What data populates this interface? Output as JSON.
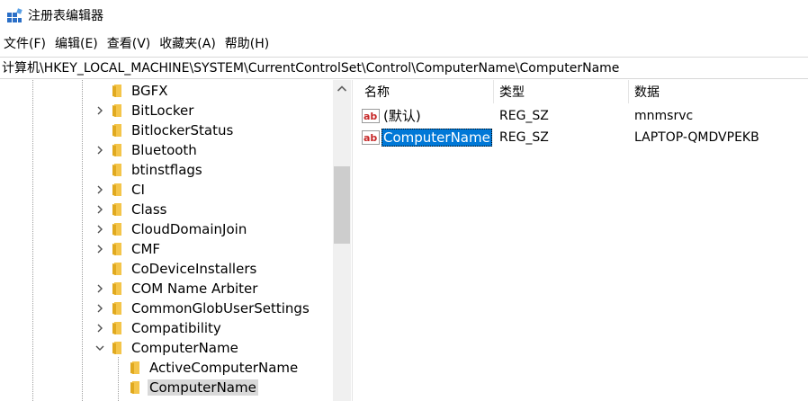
{
  "window": {
    "title": "注册表编辑器",
    "icon": "regedit-icon"
  },
  "menu": [
    "文件(F)",
    "编辑(E)",
    "查看(V)",
    "收藏夹(A)",
    "帮助(H)"
  ],
  "address": "计算机\\HKEY_LOCAL_MACHINE\\SYSTEM\\CurrentControlSet\\Control\\ComputerName\\ComputerName",
  "tree": {
    "items": [
      {
        "label": "BGFX",
        "expander": "none"
      },
      {
        "label": "BitLocker",
        "expander": "collapsed"
      },
      {
        "label": "BitlockerStatus",
        "expander": "none"
      },
      {
        "label": "Bluetooth",
        "expander": "collapsed"
      },
      {
        "label": "btinstflags",
        "expander": "none"
      },
      {
        "label": "CI",
        "expander": "collapsed"
      },
      {
        "label": "Class",
        "expander": "collapsed"
      },
      {
        "label": "CloudDomainJoin",
        "expander": "collapsed"
      },
      {
        "label": "CMF",
        "expander": "collapsed"
      },
      {
        "label": "CoDeviceInstallers",
        "expander": "none"
      },
      {
        "label": "COM Name Arbiter",
        "expander": "collapsed"
      },
      {
        "label": "CommonGlobUserSettings",
        "expander": "collapsed"
      },
      {
        "label": "Compatibility",
        "expander": "collapsed"
      },
      {
        "label": "ComputerName",
        "expander": "expanded"
      },
      {
        "label": "ActiveComputerName",
        "expander": "none",
        "child": true
      },
      {
        "label": "ComputerName",
        "expander": "none",
        "child": true,
        "selected": true
      }
    ]
  },
  "values": {
    "columns": [
      "名称",
      "类型",
      "数据"
    ],
    "rows": [
      {
        "name": "(默认)",
        "type": "REG_SZ",
        "data": "mnmsrvc",
        "icon": "string-value-icon"
      },
      {
        "name": "ComputerName",
        "type": "REG_SZ",
        "data": "LAPTOP-QMDVPEKB",
        "icon": "string-value-icon",
        "selected": true
      }
    ]
  },
  "colors": {
    "selection": "#0078d7",
    "folder": "#f4c54a",
    "tree_selection": "#d9d9d9"
  }
}
